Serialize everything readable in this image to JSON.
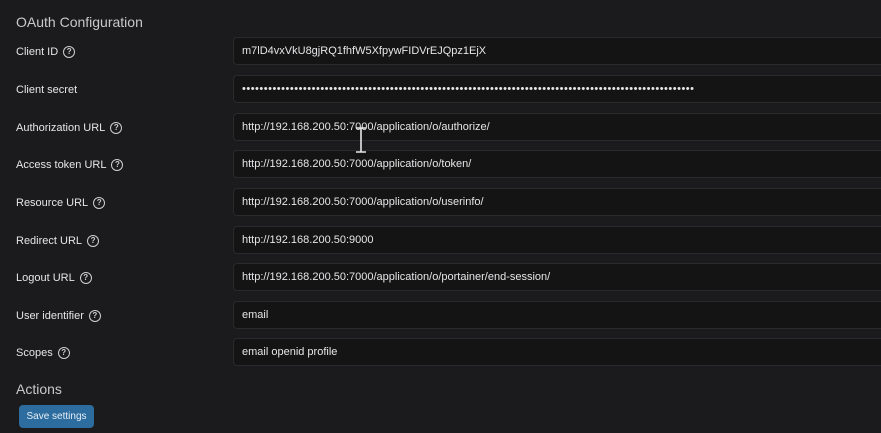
{
  "section_titles": {
    "oauth": "OAuth Configuration",
    "actions": "Actions"
  },
  "fields": [
    {
      "label": "Client ID",
      "value": "m7lD4vxVkU8gjRQ1fhfW5XfpywFIDVrEJQpz1EjX",
      "help": true
    },
    {
      "label": "Client secret",
      "value": "••••••••••••••••••••••••••••••••••••••••••••••••••••••••••••••••••••••••••••••••••••••••••••••••••••••••",
      "help": false
    },
    {
      "label": "Authorization URL",
      "value": "http://192.168.200.50:7000/application/o/authorize/",
      "help": true
    },
    {
      "label": "Access token URL",
      "value": "http://192.168.200.50:7000/application/o/token/",
      "help": true
    },
    {
      "label": "Resource URL",
      "value": "http://192.168.200.50:7000/application/o/userinfo/",
      "help": true
    },
    {
      "label": "Redirect URL",
      "value": "http://192.168.200.50:9000",
      "help": true
    },
    {
      "label": "Logout URL",
      "value": "http://192.168.200.50:7000/application/o/portainer/end-session/",
      "help": true
    },
    {
      "label": "User identifier",
      "value": "email",
      "help": true
    },
    {
      "label": "Scopes",
      "value": "email openid profile",
      "help": true
    }
  ],
  "help_icon_glyph": "?",
  "actions": {
    "save_label": "Save settings"
  },
  "colors": {
    "background": "#1b1b1d",
    "field_background": "#141415",
    "button": "#2c6c9e"
  }
}
